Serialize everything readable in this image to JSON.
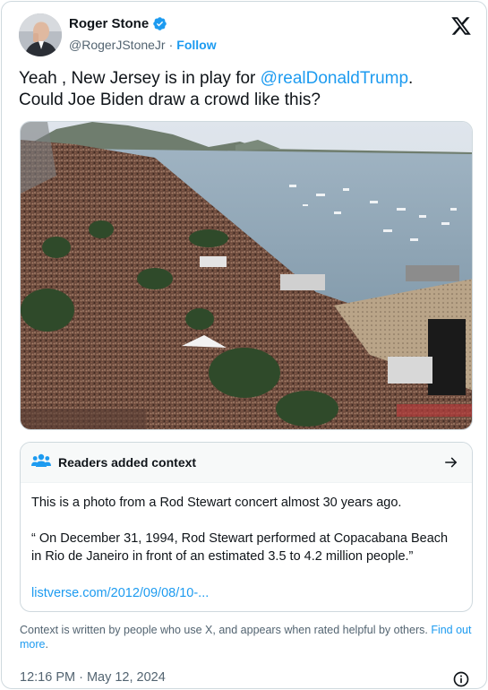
{
  "author": {
    "name": "Roger Stone",
    "handle": "@RogerJStoneJr",
    "separator": "·",
    "follow_label": "Follow",
    "verified": true
  },
  "tweet": {
    "text_before": "Yeah , New Jersey is in play for ",
    "mention": "@realDonaldTrump",
    "text_after": ".",
    "line2": "Could Joe Biden draw a crowd like this?"
  },
  "community_note": {
    "header": "Readers added context",
    "paragraph1": "This is a photo from a Rod Stewart concert almost 30 years ago.",
    "paragraph2": "“ On December 31, 1994, Rod Stewart performed at Copacabana Beach in Rio de Janeiro in front of an estimated 3.5 to 4.2 million people.”",
    "link": "listverse.com/2012/09/08/10-..."
  },
  "context_notice": {
    "text": "Context is written by people who use X, and appears when rated helpful by others. ",
    "link": "Find out more",
    "end": "."
  },
  "timestamp": "12:16 PM · May 12, 2024",
  "colors": {
    "accent": "#1d9bf0",
    "text": "#0f1419",
    "secondary": "#536471",
    "border": "#cfd9de"
  },
  "icons": [
    "verified-badge-icon",
    "x-logo-icon",
    "people-icon",
    "arrow-right-icon",
    "info-icon"
  ]
}
